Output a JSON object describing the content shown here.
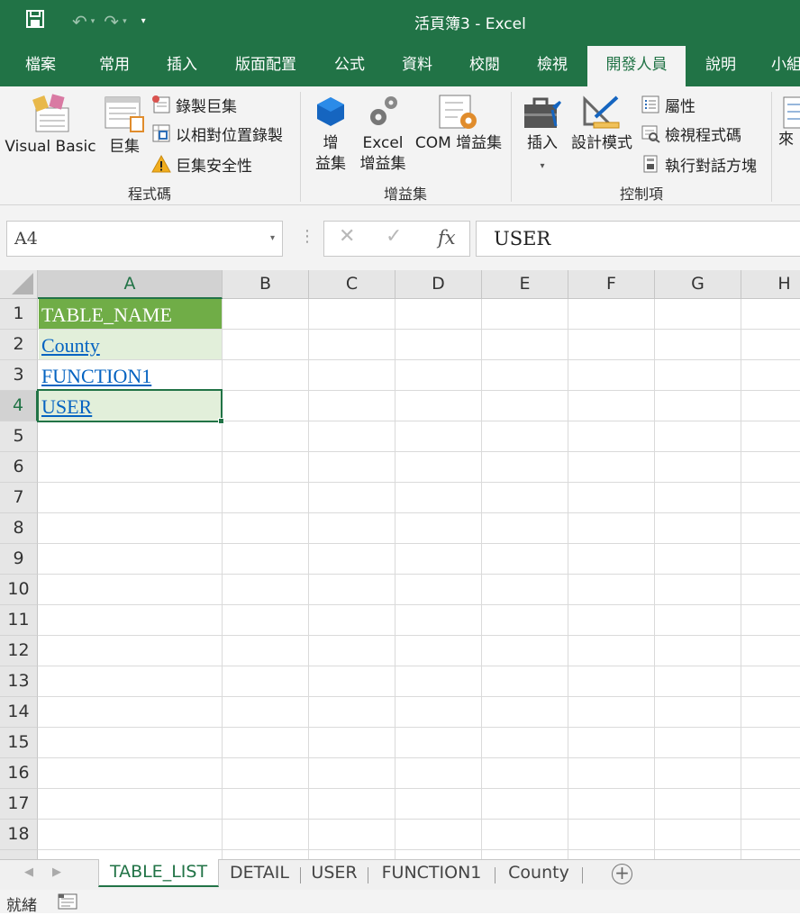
{
  "window": {
    "title": "活頁簿3  -  Excel"
  },
  "ribbon_tabs": [
    {
      "label": "檔案",
      "active": false
    },
    {
      "label": "常用",
      "active": false
    },
    {
      "label": "插入",
      "active": false
    },
    {
      "label": "版面配置",
      "active": false
    },
    {
      "label": "公式",
      "active": false
    },
    {
      "label": "資料",
      "active": false
    },
    {
      "label": "校閱",
      "active": false
    },
    {
      "label": "檢視",
      "active": false
    },
    {
      "label": "開發人員",
      "active": true
    },
    {
      "label": "說明",
      "active": false
    },
    {
      "label": "小組",
      "active": false
    }
  ],
  "ribbon": {
    "code_group": {
      "label": "程式碼",
      "visual_basic": "Visual Basic",
      "macros": "巨集",
      "record_macro": "錄製巨集",
      "relative_refs": "以相對位置錄製",
      "macro_security": "巨集安全性"
    },
    "addins_group": {
      "label": "增益集",
      "addins_line1": "增",
      "addins_line2": "益集",
      "excel_addins_line1": "Excel",
      "excel_addins_line2": "增益集",
      "com_addins": "COM 增益集"
    },
    "controls_group": {
      "label": "控制項",
      "insert": "插入",
      "design_mode": "設計模式",
      "properties": "屬性",
      "view_code": "檢視程式碼",
      "run_dialog": "執行對話方塊"
    },
    "partial_next": "來"
  },
  "formula_bar": {
    "name_box": "A4",
    "cancel": "✕",
    "enter": "✓",
    "fx": "fx",
    "value": "USER"
  },
  "columns": [
    "A",
    "B",
    "C",
    "D",
    "E",
    "F",
    "G",
    "H"
  ],
  "rows": [
    "1",
    "2",
    "3",
    "4",
    "5",
    "6",
    "7",
    "8",
    "9",
    "10",
    "11",
    "12",
    "13",
    "14",
    "15",
    "16",
    "17",
    "18"
  ],
  "cells": {
    "A1": "TABLE_NAME",
    "A2": "County",
    "A3": "FUNCTION1",
    "A4": "USER"
  },
  "sheet_tabs": [
    {
      "label": "TABLE_LIST",
      "active": true
    },
    {
      "label": "DETAIL",
      "active": false
    },
    {
      "label": "USER",
      "active": false
    },
    {
      "label": "FUNCTION1",
      "active": false
    },
    {
      "label": "County",
      "active": false
    }
  ],
  "status": {
    "ready": "就緒"
  },
  "colors": {
    "excel_green": "#217346",
    "table_header": "#70ad47",
    "table_band": "#e2efda",
    "hyperlink": "#0563c1"
  }
}
